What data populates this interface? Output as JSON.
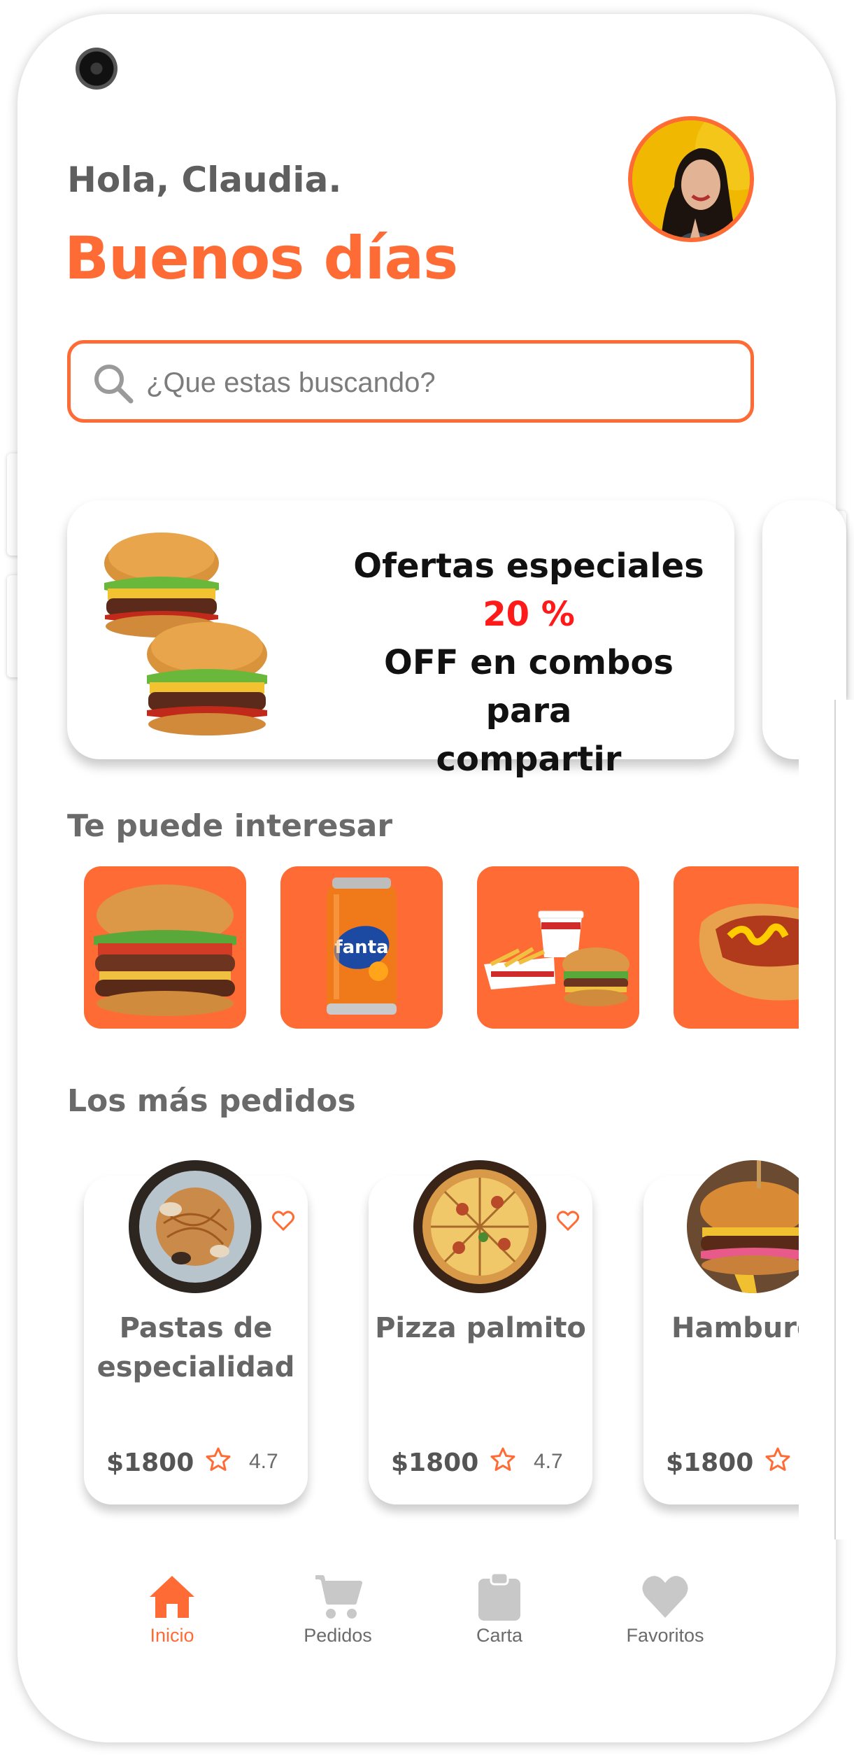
{
  "colors": {
    "accent": "#ff6b35",
    "highlight": "#ff1a1a",
    "inactive_icon": "#c8c8c8"
  },
  "header": {
    "greeting": "Hola, Claudia.",
    "title": "Buenos días",
    "avatar_icon": "user-avatar"
  },
  "search": {
    "placeholder": "¿Que estas buscando?",
    "icon": "search-icon"
  },
  "promo": {
    "line1": "Ofertas especiales ",
    "highlight": "20 %",
    "line2": "OFF en combos para",
    "line3": "compartir"
  },
  "interest": {
    "title": "Te puede interesar",
    "items": [
      "burger",
      "fanta-can",
      "combo-meal",
      "hotdog"
    ]
  },
  "popular": {
    "title": "Los más pedidos",
    "items": [
      {
        "name_line1": "Pastas de",
        "name_line2": "especialidad",
        "price": "$1800",
        "rating": "4.7"
      },
      {
        "name_line1": "Pizza palmito",
        "name_line2": "",
        "price": "$1800",
        "rating": "4.7"
      },
      {
        "name_line1": "Hamburg",
        "name_line2": "",
        "price": "$1800",
        "rating": ""
      }
    ]
  },
  "nav": {
    "items": [
      {
        "label": "Inicio",
        "icon": "home-icon",
        "active": true
      },
      {
        "label": "Pedidos",
        "icon": "cart-icon",
        "active": false
      },
      {
        "label": "Carta",
        "icon": "clipboard-icon",
        "active": false
      },
      {
        "label": "Favoritos",
        "icon": "heart-icon",
        "active": false
      }
    ]
  }
}
